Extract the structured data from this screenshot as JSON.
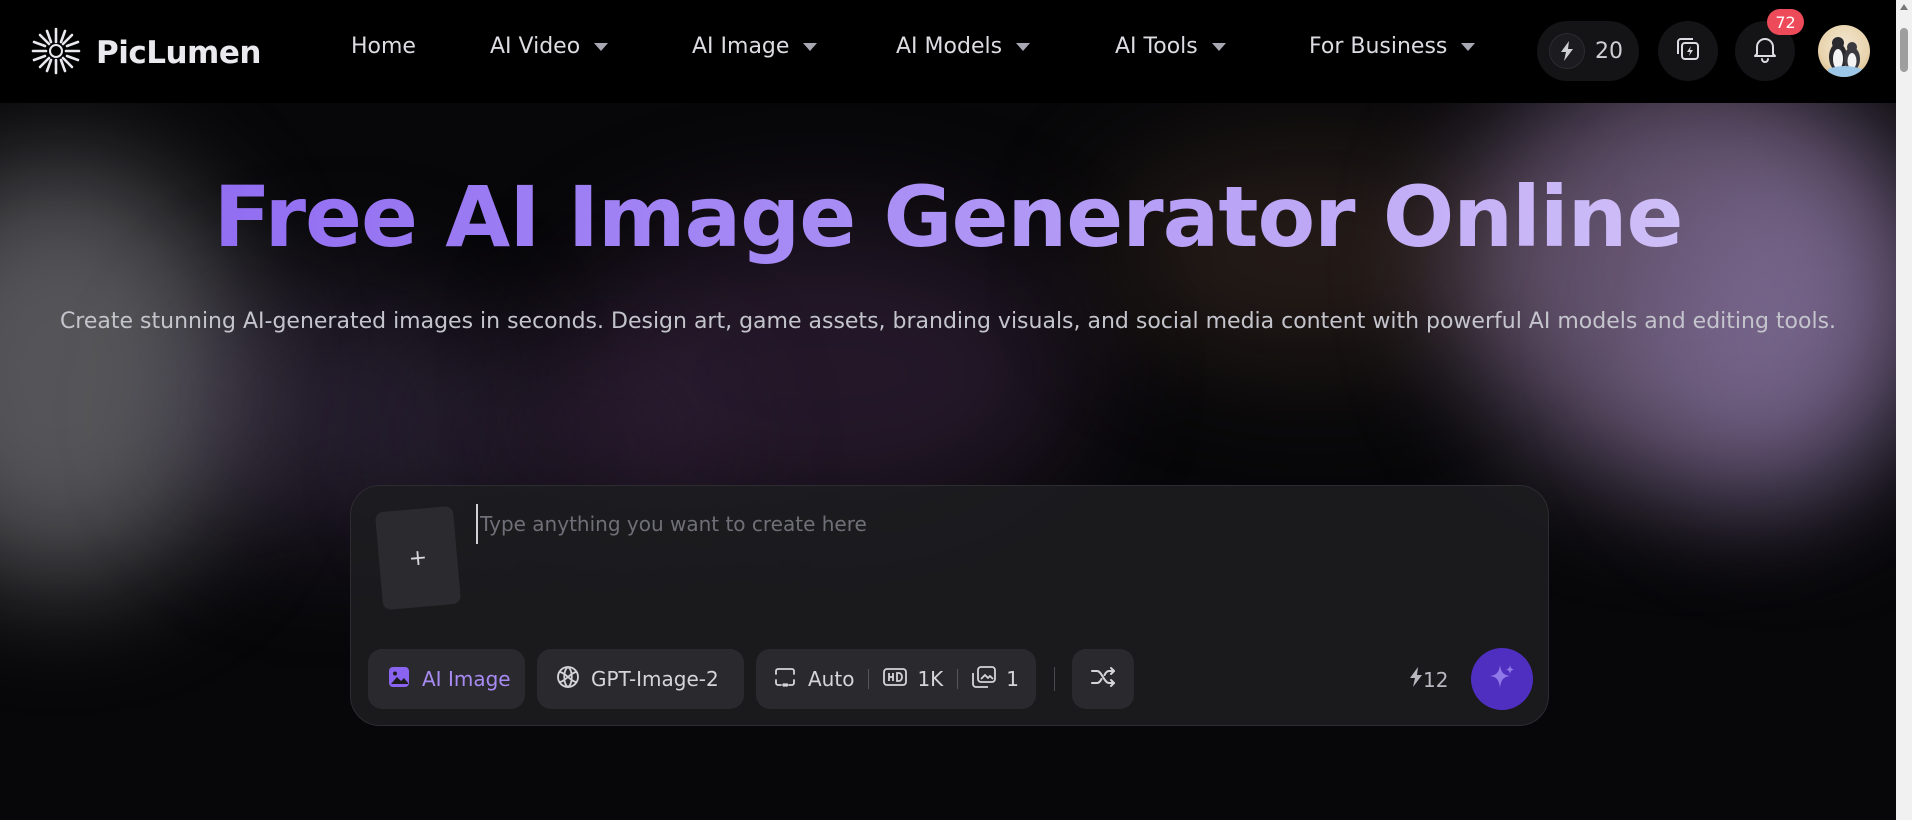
{
  "brand": {
    "name": "PicLumen"
  },
  "nav": {
    "items": [
      {
        "label": "Home",
        "has_dropdown": false
      },
      {
        "label": "AI Video",
        "has_dropdown": true
      },
      {
        "label": "AI Image",
        "has_dropdown": true
      },
      {
        "label": "AI Models",
        "has_dropdown": true
      },
      {
        "label": "AI Tools",
        "has_dropdown": true
      },
      {
        "label": "For Business",
        "has_dropdown": true
      }
    ]
  },
  "header": {
    "credits": "20",
    "notifications_count": "72"
  },
  "hero": {
    "title": "Free AI Image Generator Online",
    "subtitle": "Create stunning AI-generated images in seconds. Design art, game assets, branding visuals, and social media content with powerful AI models and editing tools."
  },
  "prompt": {
    "placeholder": "Type anything you want to create here",
    "value": "",
    "upload_symbol": "+",
    "mode_label": "AI Image",
    "model_label": "GPT-Image-2",
    "aspect_label": "Auto",
    "resolution_label": "1K",
    "image_count_label": "1",
    "cost": "12"
  },
  "colors": {
    "accent": "#8a63f0",
    "generate_button": "#4f2fc0",
    "badge": "#ee4b5a",
    "background": "#060608"
  },
  "icons": {
    "logo": "sunburst-logo-icon",
    "credits": "lightning-icon",
    "history": "layers-icon",
    "notifications": "bell-icon",
    "mode": "image-icon",
    "model": "openai-icon",
    "aspect": "aspect-ratio-icon",
    "resolution": "hd-icon",
    "count": "images-icon",
    "shuffle": "shuffle-icon",
    "generate": "sparkle-icon"
  }
}
